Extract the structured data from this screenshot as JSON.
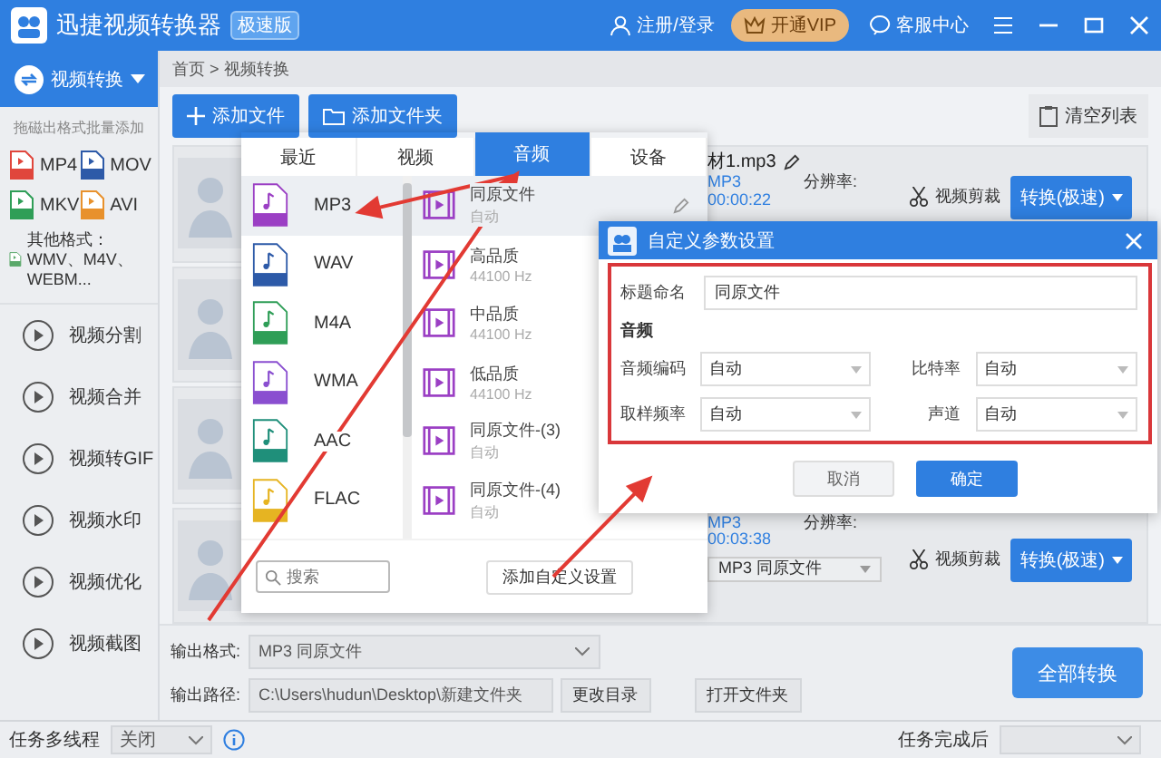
{
  "title_bar": {
    "app_name": "迅捷视频转换器",
    "edition_badge": "极速版",
    "login": "注册/登录",
    "vip": "开通VIP",
    "support": "客服中心"
  },
  "sidebar": {
    "current": "视频转换",
    "hint": "拖磁出格式批量添加",
    "formats": [
      {
        "label": "MP4",
        "color": "#e0463c"
      },
      {
        "label": "MOV",
        "color": "#2d5aa8"
      },
      {
        "label": "MKV",
        "color": "#2f9e57"
      },
      {
        "label": "AVI",
        "color": "#e8912c"
      },
      {
        "label": "其他格式：WMV、M4V、WEBM...",
        "color": "#5aa86a"
      }
    ],
    "items": [
      "视频分割",
      "视频合并",
      "视频转GIF",
      "视频水印",
      "视频优化",
      "视频截图"
    ]
  },
  "breadcrumb": "首页 > 视频转换",
  "toolbar": {
    "add_file": "添加文件",
    "add_folder": "添加文件夹",
    "clear": "清空列表"
  },
  "files": [
    {
      "kind": "details",
      "name": "材1.mp3",
      "format": "MP3",
      "duration": "00:00:22",
      "resolution_label": "分辨率:",
      "trim": "视频剪裁",
      "convert": "转换(极速)"
    },
    {
      "kind": "covered"
    },
    {
      "kind": "covered"
    },
    {
      "kind": "details",
      "format": "MP3",
      "duration": "00:03:38",
      "resolution_label": "分辨率:",
      "trim": "视频剪裁",
      "convert": "转换(极速)",
      "output": "MP3  同原文件"
    }
  ],
  "output": {
    "format_label": "输出格式:",
    "format_value": "MP3  同原文件",
    "path_label": "输出路径:",
    "path_value": "C:\\Users\\hudun\\Desktop\\新建文件夹",
    "change_dir": "更改目录",
    "open_folder": "打开文件夹",
    "convert_all": "全部转换"
  },
  "status_bar": {
    "threads_label": "任务多线程",
    "threads_value": "关闭",
    "after_label": "任务完成后"
  },
  "format_picker": {
    "tabs": [
      {
        "label": "最近",
        "selected": false
      },
      {
        "label": "视频",
        "selected": false
      },
      {
        "label": "音频",
        "selected": true
      },
      {
        "label": "设备",
        "selected": false
      }
    ],
    "formats": [
      {
        "label": "MP3",
        "color": "#9b3fc4",
        "selected": true
      },
      {
        "label": "WAV",
        "color": "#2d5aa8",
        "selected": false
      },
      {
        "label": "M4A",
        "color": "#2f9e57",
        "selected": false
      },
      {
        "label": "WMA",
        "color": "#8a4fd0",
        "selected": false
      },
      {
        "label": "AAC",
        "color": "#1f8f7a",
        "selected": false
      },
      {
        "label": "FLAC",
        "color": "#e6b422",
        "selected": false
      }
    ],
    "presets": [
      {
        "name": "同原文件",
        "detail": "自动",
        "selected": true
      },
      {
        "name": "高品质",
        "detail": "44100 Hz",
        "selected": false
      },
      {
        "name": "中品质",
        "detail": "44100 Hz",
        "selected": false
      },
      {
        "name": "低品质",
        "detail": "44100 Hz",
        "selected": false
      },
      {
        "name": "同原文件-(3)",
        "detail": "自动",
        "selected": false
      },
      {
        "name": "同原文件-(4)",
        "detail": "自动",
        "selected": false
      }
    ],
    "search_placeholder": "搜索",
    "add_custom": "添加自定义设置"
  },
  "dialog": {
    "title": "自定义参数设置",
    "name_label": "标题命名",
    "name_value": "同原文件",
    "section": "音频",
    "fields": [
      {
        "label": "音频编码",
        "value": "自动"
      },
      {
        "label": "比特率",
        "value": "自动"
      },
      {
        "label": "取样频率",
        "value": "自动"
      },
      {
        "label": "声道",
        "value": "自动"
      }
    ],
    "cancel": "取消",
    "ok": "确定"
  }
}
